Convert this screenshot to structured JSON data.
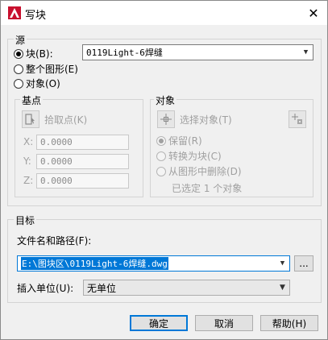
{
  "window": {
    "title": "写块",
    "close_glyph": "✕"
  },
  "source": {
    "label": "源",
    "options": [
      {
        "label": "块(B):",
        "selected": true
      },
      {
        "label": "整个图形(E)",
        "selected": false
      },
      {
        "label": "对象(O)",
        "selected": false
      }
    ],
    "block_value": "0119Light-6焊缝"
  },
  "base_point": {
    "label": "基点",
    "pick_label": "拾取点(K)",
    "x_label": "X:",
    "x_value": "0.0000",
    "y_label": "Y:",
    "y_value": "0.0000",
    "z_label": "Z:",
    "z_value": "0.0000"
  },
  "objects": {
    "label": "对象",
    "select_label": "选择对象(T)",
    "options": [
      {
        "label": "保留(R)",
        "selected": true
      },
      {
        "label": "转换为块(C)",
        "selected": false
      },
      {
        "label": "从图形中删除(D)",
        "selected": false
      }
    ],
    "status": "已选定 1 个对象"
  },
  "target": {
    "label": "目标",
    "path_label": "文件名和路径(F):",
    "path_value": "E:\\图块区\\0119Light-6焊缝.dwg",
    "browse_label": "...",
    "units_label": "插入单位(U):",
    "units_value": "无单位"
  },
  "buttons": {
    "ok": "确定",
    "cancel": "取消",
    "help": "帮助(H)"
  },
  "colors": {
    "accent": "#0078d7",
    "app_icon": "#d0021b"
  }
}
